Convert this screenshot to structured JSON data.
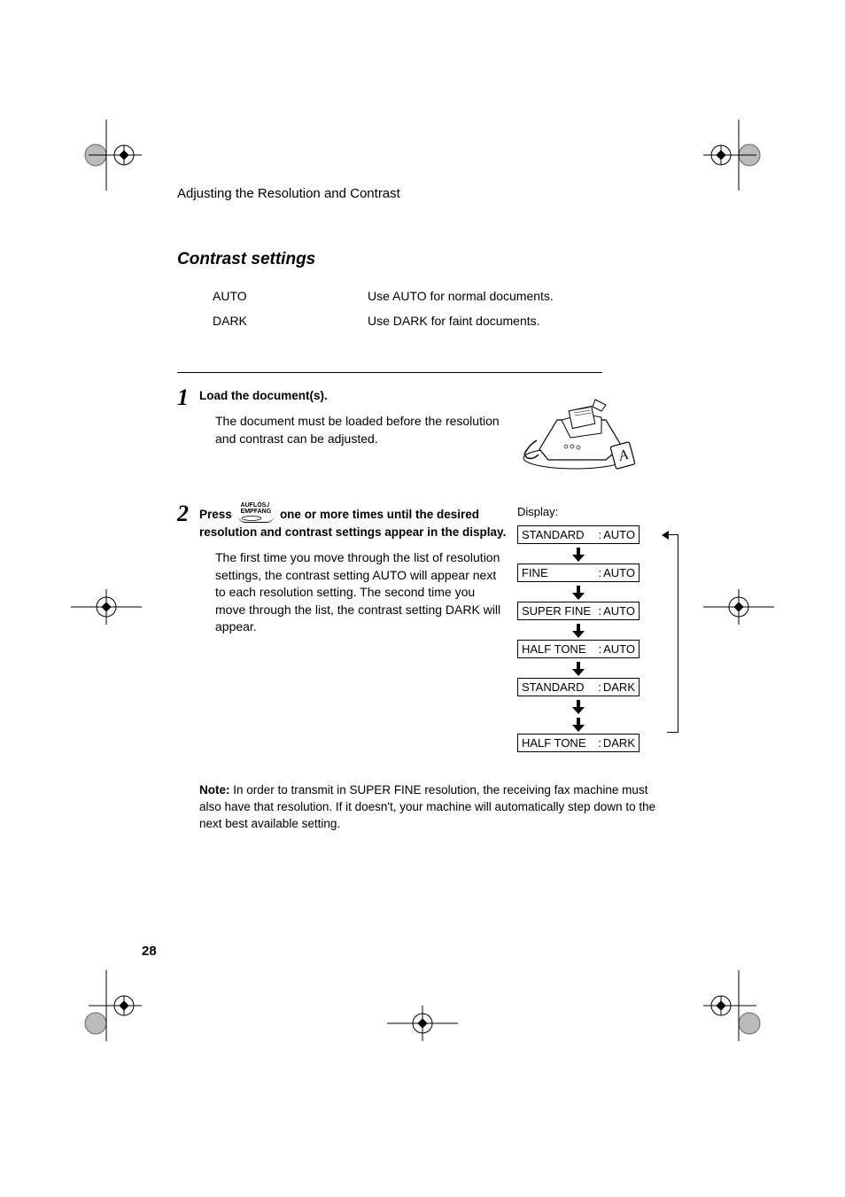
{
  "header": "Adjusting the Resolution and Contrast",
  "section_title": "Contrast settings",
  "contrast": [
    {
      "label": "AUTO",
      "desc": "Use AUTO for normal documents."
    },
    {
      "label": "DARK",
      "desc": "Use DARK for faint documents."
    }
  ],
  "step1": {
    "num": "1",
    "title": "Load the document(s).",
    "body": "The document must be loaded before the resolution and contrast can be adjusted."
  },
  "step2": {
    "num": "2",
    "title_pre": "Press ",
    "button_line1": "AUFLÖS./",
    "button_line2": "EMPFANG",
    "title_post": " one or more times until the desired resolution and contrast settings appear in the display.",
    "body": "The first time you move through the list of resolution settings, the contrast setting AUTO will appear next to each resolution setting. The second time you move through the list, the contrast setting DARK will appear.",
    "display_label": "Display:"
  },
  "display_states": [
    {
      "res": "STANDARD",
      "con": "AUTO"
    },
    {
      "res": "FINE",
      "con": "AUTO"
    },
    {
      "res": "SUPER FINE",
      "con": "AUTO"
    },
    {
      "res": "HALF TONE",
      "con": "AUTO"
    },
    {
      "res": "STANDARD",
      "con": "DARK"
    },
    {
      "res": "HALF TONE",
      "con": "DARK"
    }
  ],
  "note": {
    "label": "Note:",
    "text": " In order to transmit in SUPER FINE resolution, the receiving fax machine must also have that resolution. If it doesn't, your machine will automatically step down to the next best available setting."
  },
  "page_number": "28"
}
